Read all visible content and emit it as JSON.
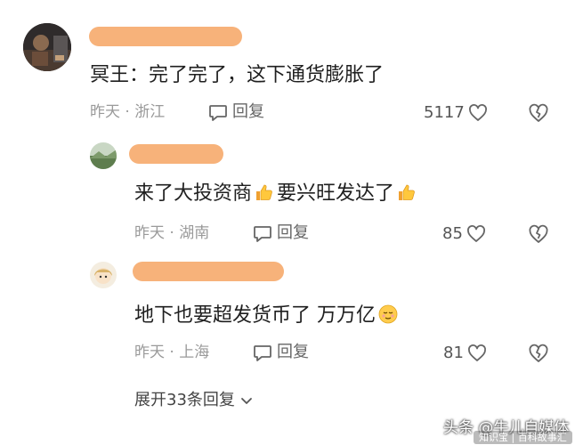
{
  "colors": {
    "name_placeholder": "#f7b27a",
    "meta_text": "#9a9a9a",
    "content_text": "#1f1f1f"
  },
  "comments": [
    {
      "content_prefix": "冥王：完了完了，这下通货膨胀了",
      "content_suffix": "",
      "meta": "昨天 · 浙江",
      "reply_label": "回复",
      "likes": "5117",
      "emoji": "",
      "avatar_icon": "dark-portrait-avatar"
    },
    {
      "content_prefix": "来了大投资商",
      "content_suffix": "要兴旺发达了",
      "meta": "昨天 · 湖南",
      "reply_label": "回复",
      "likes": "85",
      "emoji": "thumbs-up-icon",
      "avatar_icon": "landscape-avatar"
    },
    {
      "content_prefix": "地下也要超发货币了 万万亿",
      "content_suffix": "",
      "meta": "昨天 · 上海",
      "reply_label": "回复",
      "likes": "81",
      "emoji": "relieved-face-icon",
      "avatar_icon": "cartoon-girl-avatar"
    }
  ],
  "expand_label": "展开33条回复",
  "watermark": {
    "main": "头条 @牛儿自媒体",
    "sub": "知识宝 | 百科故事汇"
  }
}
